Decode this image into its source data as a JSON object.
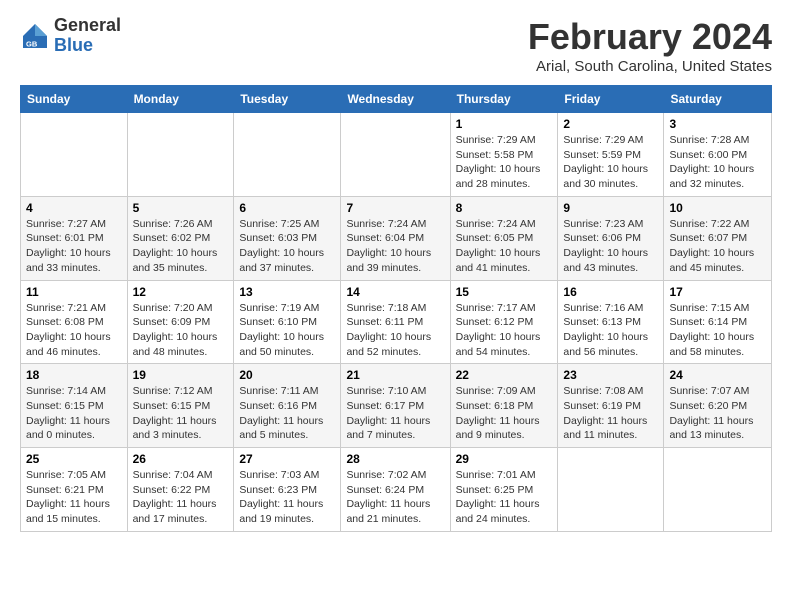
{
  "header": {
    "logo_general": "General",
    "logo_blue": "Blue",
    "month_title": "February 2024",
    "location": "Arial, South Carolina, United States"
  },
  "weekdays": [
    "Sunday",
    "Monday",
    "Tuesday",
    "Wednesday",
    "Thursday",
    "Friday",
    "Saturday"
  ],
  "weeks": [
    [
      {
        "day": "",
        "info": ""
      },
      {
        "day": "",
        "info": ""
      },
      {
        "day": "",
        "info": ""
      },
      {
        "day": "",
        "info": ""
      },
      {
        "day": "1",
        "info": "Sunrise: 7:29 AM\nSunset: 5:58 PM\nDaylight: 10 hours\nand 28 minutes."
      },
      {
        "day": "2",
        "info": "Sunrise: 7:29 AM\nSunset: 5:59 PM\nDaylight: 10 hours\nand 30 minutes."
      },
      {
        "day": "3",
        "info": "Sunrise: 7:28 AM\nSunset: 6:00 PM\nDaylight: 10 hours\nand 32 minutes."
      }
    ],
    [
      {
        "day": "4",
        "info": "Sunrise: 7:27 AM\nSunset: 6:01 PM\nDaylight: 10 hours\nand 33 minutes."
      },
      {
        "day": "5",
        "info": "Sunrise: 7:26 AM\nSunset: 6:02 PM\nDaylight: 10 hours\nand 35 minutes."
      },
      {
        "day": "6",
        "info": "Sunrise: 7:25 AM\nSunset: 6:03 PM\nDaylight: 10 hours\nand 37 minutes."
      },
      {
        "day": "7",
        "info": "Sunrise: 7:24 AM\nSunset: 6:04 PM\nDaylight: 10 hours\nand 39 minutes."
      },
      {
        "day": "8",
        "info": "Sunrise: 7:24 AM\nSunset: 6:05 PM\nDaylight: 10 hours\nand 41 minutes."
      },
      {
        "day": "9",
        "info": "Sunrise: 7:23 AM\nSunset: 6:06 PM\nDaylight: 10 hours\nand 43 minutes."
      },
      {
        "day": "10",
        "info": "Sunrise: 7:22 AM\nSunset: 6:07 PM\nDaylight: 10 hours\nand 45 minutes."
      }
    ],
    [
      {
        "day": "11",
        "info": "Sunrise: 7:21 AM\nSunset: 6:08 PM\nDaylight: 10 hours\nand 46 minutes."
      },
      {
        "day": "12",
        "info": "Sunrise: 7:20 AM\nSunset: 6:09 PM\nDaylight: 10 hours\nand 48 minutes."
      },
      {
        "day": "13",
        "info": "Sunrise: 7:19 AM\nSunset: 6:10 PM\nDaylight: 10 hours\nand 50 minutes."
      },
      {
        "day": "14",
        "info": "Sunrise: 7:18 AM\nSunset: 6:11 PM\nDaylight: 10 hours\nand 52 minutes."
      },
      {
        "day": "15",
        "info": "Sunrise: 7:17 AM\nSunset: 6:12 PM\nDaylight: 10 hours\nand 54 minutes."
      },
      {
        "day": "16",
        "info": "Sunrise: 7:16 AM\nSunset: 6:13 PM\nDaylight: 10 hours\nand 56 minutes."
      },
      {
        "day": "17",
        "info": "Sunrise: 7:15 AM\nSunset: 6:14 PM\nDaylight: 10 hours\nand 58 minutes."
      }
    ],
    [
      {
        "day": "18",
        "info": "Sunrise: 7:14 AM\nSunset: 6:15 PM\nDaylight: 11 hours\nand 0 minutes."
      },
      {
        "day": "19",
        "info": "Sunrise: 7:12 AM\nSunset: 6:15 PM\nDaylight: 11 hours\nand 3 minutes."
      },
      {
        "day": "20",
        "info": "Sunrise: 7:11 AM\nSunset: 6:16 PM\nDaylight: 11 hours\nand 5 minutes."
      },
      {
        "day": "21",
        "info": "Sunrise: 7:10 AM\nSunset: 6:17 PM\nDaylight: 11 hours\nand 7 minutes."
      },
      {
        "day": "22",
        "info": "Sunrise: 7:09 AM\nSunset: 6:18 PM\nDaylight: 11 hours\nand 9 minutes."
      },
      {
        "day": "23",
        "info": "Sunrise: 7:08 AM\nSunset: 6:19 PM\nDaylight: 11 hours\nand 11 minutes."
      },
      {
        "day": "24",
        "info": "Sunrise: 7:07 AM\nSunset: 6:20 PM\nDaylight: 11 hours\nand 13 minutes."
      }
    ],
    [
      {
        "day": "25",
        "info": "Sunrise: 7:05 AM\nSunset: 6:21 PM\nDaylight: 11 hours\nand 15 minutes."
      },
      {
        "day": "26",
        "info": "Sunrise: 7:04 AM\nSunset: 6:22 PM\nDaylight: 11 hours\nand 17 minutes."
      },
      {
        "day": "27",
        "info": "Sunrise: 7:03 AM\nSunset: 6:23 PM\nDaylight: 11 hours\nand 19 minutes."
      },
      {
        "day": "28",
        "info": "Sunrise: 7:02 AM\nSunset: 6:24 PM\nDaylight: 11 hours\nand 21 minutes."
      },
      {
        "day": "29",
        "info": "Sunrise: 7:01 AM\nSunset: 6:25 PM\nDaylight: 11 hours\nand 24 minutes."
      },
      {
        "day": "",
        "info": ""
      },
      {
        "day": "",
        "info": ""
      }
    ]
  ]
}
